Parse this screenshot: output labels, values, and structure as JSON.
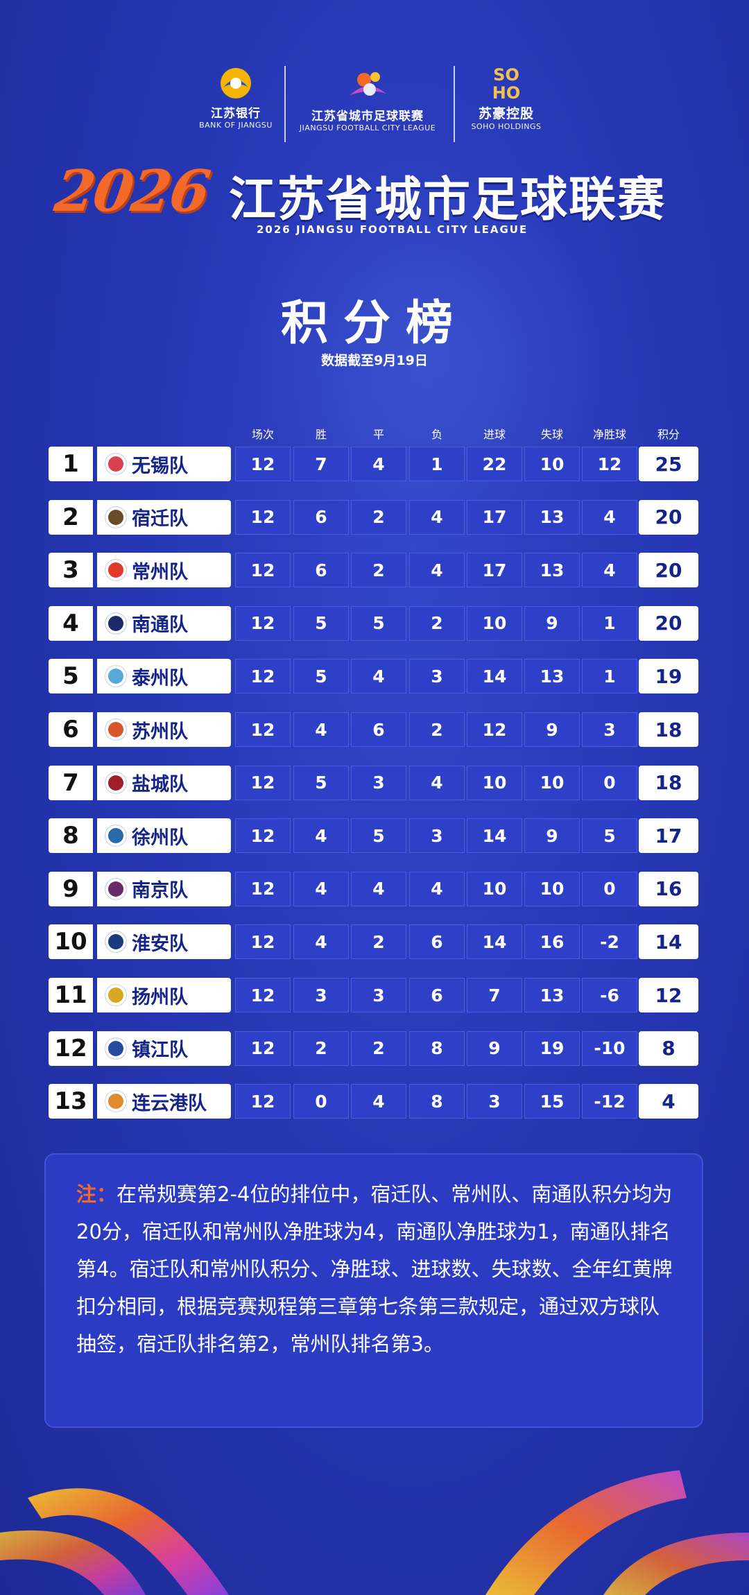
{
  "sponsors": {
    "bank": {
      "name": "江苏银行",
      "sub": "BANK OF JIANGSU"
    },
    "league": {
      "name": "江苏省城市足球联赛",
      "sub": "JIANGSU FOOTBALL CITY LEAGUE"
    },
    "soho": {
      "mark": "SO HO",
      "name": "苏豪控股",
      "sub": "SOHO HOLDINGS"
    }
  },
  "title": {
    "year": "2026",
    "league": "江苏省城市足球联赛",
    "league_en": "2026 JIANGSU FOOTBALL CITY LEAGUE",
    "board": "积分榜",
    "as_of": "数据截至9月19日"
  },
  "headers": [
    "场次",
    "胜",
    "平",
    "负",
    "进球",
    "失球",
    "净胜球",
    "积分"
  ],
  "standings": [
    {
      "rank": "1",
      "team": "无锡队",
      "played": "12",
      "won": "7",
      "drawn": "4",
      "lost": "1",
      "gf": "22",
      "ga": "10",
      "gd": "12",
      "pts": "25",
      "badge_color": "#d94050"
    },
    {
      "rank": "2",
      "team": "宿迁队",
      "played": "12",
      "won": "6",
      "drawn": "2",
      "lost": "4",
      "gf": "17",
      "ga": "13",
      "gd": "4",
      "pts": "20",
      "badge_color": "#6b4a2a"
    },
    {
      "rank": "3",
      "team": "常州队",
      "played": "12",
      "won": "6",
      "drawn": "2",
      "lost": "4",
      "gf": "17",
      "ga": "13",
      "gd": "4",
      "pts": "20",
      "badge_color": "#e03a2a"
    },
    {
      "rank": "4",
      "team": "南通队",
      "played": "12",
      "won": "5",
      "drawn": "5",
      "lost": "2",
      "gf": "10",
      "ga": "9",
      "gd": "1",
      "pts": "20",
      "badge_color": "#1c2a6a"
    },
    {
      "rank": "5",
      "team": "泰州队",
      "played": "12",
      "won": "5",
      "drawn": "4",
      "lost": "3",
      "gf": "14",
      "ga": "13",
      "gd": "1",
      "pts": "19",
      "badge_color": "#5aa8d8"
    },
    {
      "rank": "6",
      "team": "苏州队",
      "played": "12",
      "won": "4",
      "drawn": "6",
      "lost": "2",
      "gf": "12",
      "ga": "9",
      "gd": "3",
      "pts": "18",
      "badge_color": "#d8552a"
    },
    {
      "rank": "7",
      "team": "盐城队",
      "played": "12",
      "won": "5",
      "drawn": "3",
      "lost": "4",
      "gf": "10",
      "ga": "10",
      "gd": "0",
      "pts": "18",
      "badge_color": "#a0202a"
    },
    {
      "rank": "8",
      "team": "徐州队",
      "played": "12",
      "won": "4",
      "drawn": "5",
      "lost": "3",
      "gf": "14",
      "ga": "9",
      "gd": "5",
      "pts": "17",
      "badge_color": "#2a6aa8"
    },
    {
      "rank": "9",
      "team": "南京队",
      "played": "12",
      "won": "4",
      "drawn": "4",
      "lost": "4",
      "gf": "10",
      "ga": "10",
      "gd": "0",
      "pts": "16",
      "badge_color": "#6a2a6a"
    },
    {
      "rank": "10",
      "team": "淮安队",
      "played": "12",
      "won": "4",
      "drawn": "2",
      "lost": "6",
      "gf": "14",
      "ga": "16",
      "gd": "-2",
      "pts": "14",
      "badge_color": "#1a3a7a"
    },
    {
      "rank": "11",
      "team": "扬州队",
      "played": "12",
      "won": "3",
      "drawn": "3",
      "lost": "6",
      "gf": "7",
      "ga": "13",
      "gd": "-6",
      "pts": "12",
      "badge_color": "#d8a820"
    },
    {
      "rank": "12",
      "team": "镇江队",
      "played": "12",
      "won": "2",
      "drawn": "2",
      "lost": "8",
      "gf": "9",
      "ga": "19",
      "gd": "-10",
      "pts": "8",
      "badge_color": "#2a4aa0"
    },
    {
      "rank": "13",
      "team": "连云港队",
      "played": "12",
      "won": "0",
      "drawn": "4",
      "lost": "8",
      "gf": "3",
      "ga": "15",
      "gd": "-12",
      "pts": "4",
      "badge_color": "#e08a2a"
    }
  ],
  "note": {
    "label": "注：",
    "text": "在常规赛第2-4位的排位中，宿迁队、常州队、南通队积分均为20分，宿迁队和常州队净胜球为4，南通队净胜球为1，南通队排名第4。宿迁队和常州队积分、净胜球、进球数、失球数、全年红黄牌扣分相同，根据竞赛规程第三章第七条第三款规定，通过双方球队抽签，宿迁队排名第2，常州队排名第3。"
  },
  "colors": {
    "background": "#2637b4",
    "accent": "#f2692a",
    "cell": "#2f40c8"
  }
}
